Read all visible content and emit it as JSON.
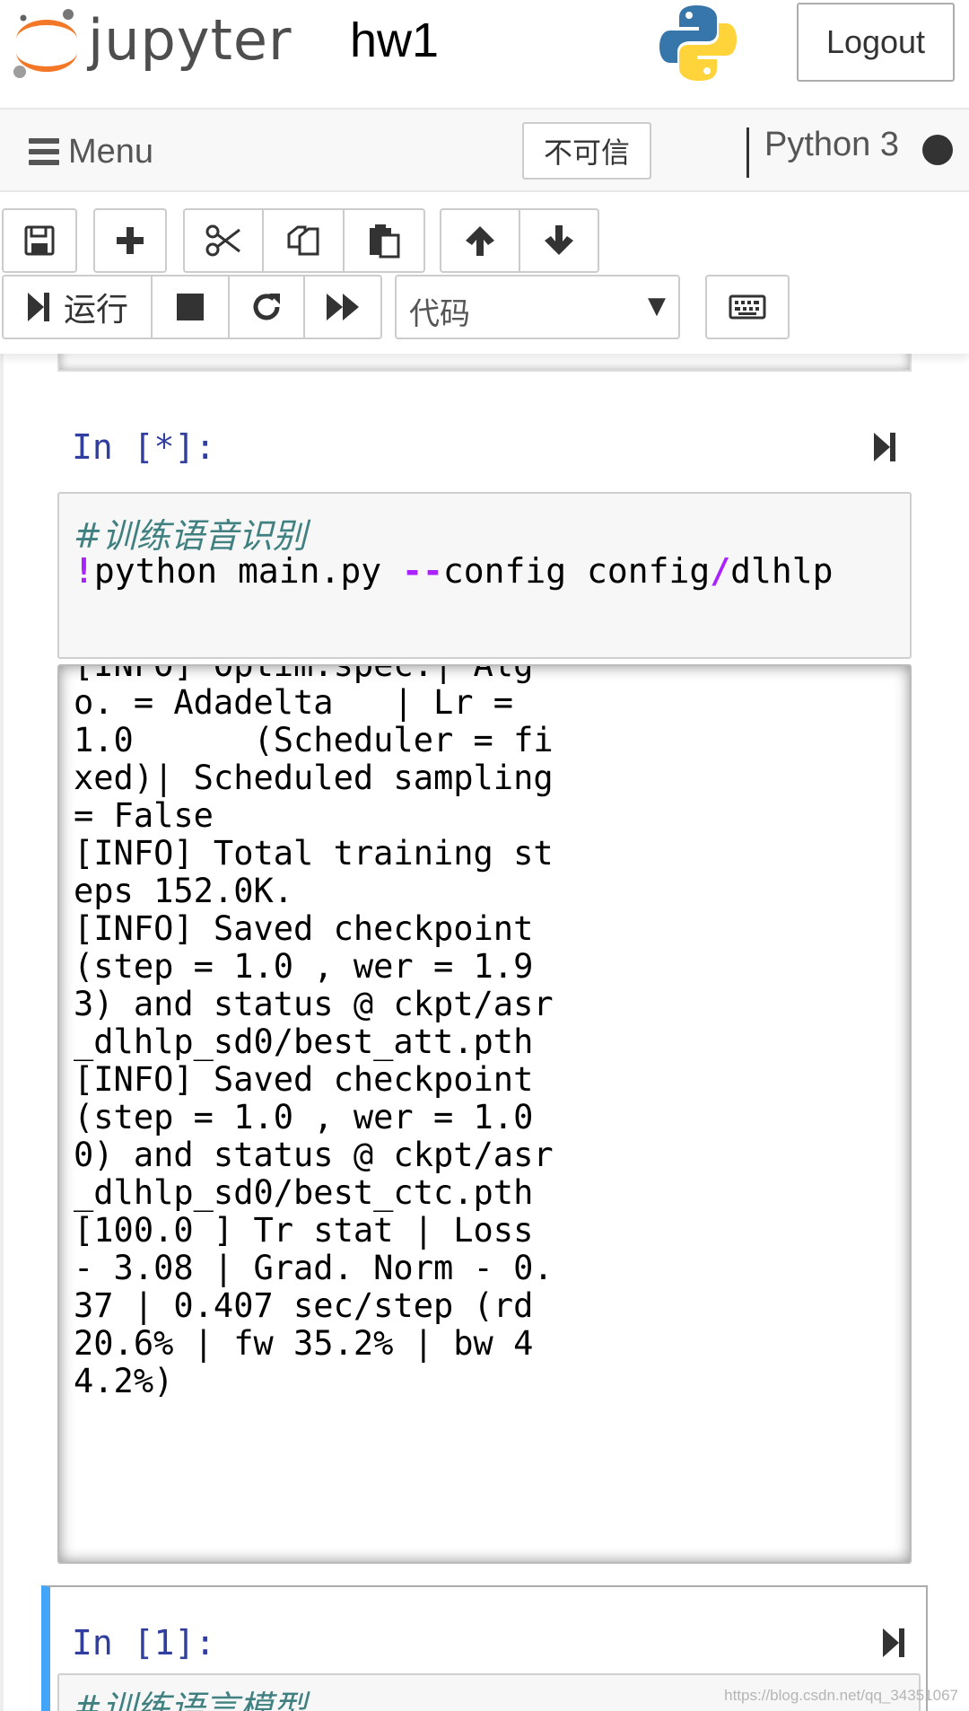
{
  "header": {
    "logo_text": "jupyter",
    "notebook_name": "hw1",
    "logout_label": "Logout"
  },
  "menubar": {
    "menu_label": "Menu",
    "trust_label": "不可信",
    "kernel_name": "Python 3"
  },
  "toolbar": {
    "icons": [
      "save-icon",
      "plus-icon",
      "cut-icon",
      "copy-icon",
      "paste-icon",
      "arrow-up-icon",
      "arrow-down-icon",
      "step-forward-icon",
      "stop-icon",
      "restart-icon",
      "fast-forward-icon",
      "keyboard-icon"
    ],
    "run_label": "运行",
    "cell_type": "代码"
  },
  "cells": [
    {
      "prompt": "In [*]:",
      "comment": "#训练语音识别",
      "code": {
        "bang": "!",
        "part1": "python main.py ",
        "op": "--",
        "part2": "config config",
        "slash": "/",
        "part3": "dlhlp"
      },
      "output_lines": [
        "[INFO] Optim.spec.| Alg",
        "o. = Adadelta   | Lr =",
        "1.0      (Scheduler = fi",
        "xed)| Scheduled sampling",
        "= False",
        "[INFO] Total training st",
        "eps 152.0K.",
        "[INFO] Saved checkpoint",
        "(step = 1.0 , wer = 1.9",
        "3) and status @ ckpt/asr",
        "_dlhlp_sd0/best_att.pth",
        "[INFO] Saved checkpoint",
        "(step = 1.0 , wer = 1.0",
        "0) and status @ ckpt/asr",
        "_dlhlp_sd0/best_ctc.pth",
        "[100.0 ] Tr stat | Loss",
        "- 3.08 | Grad. Norm - 0.",
        "37 | 0.407 sec/step (rd",
        "20.6% | fw 35.2% | bw 4",
        "4.2%)"
      ]
    },
    {
      "prompt": "In [1]:",
      "comment": "#训练语言模型"
    }
  ],
  "colors": {
    "prompt": "#303f9f",
    "comment": "#408080",
    "magic": "#aa22ff",
    "selected_cell": "#42a5f5"
  },
  "watermark": "https://blog.csdn.net/qq_34351067"
}
